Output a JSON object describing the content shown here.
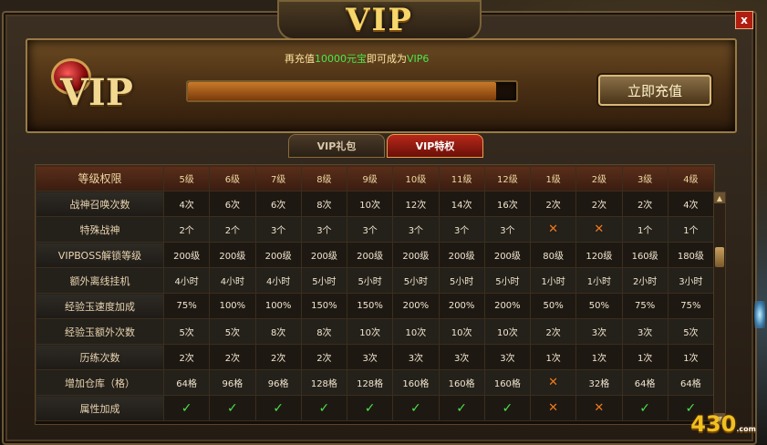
{
  "window": {
    "title": "VIP",
    "close_label": "x"
  },
  "banner": {
    "logo_text": "VIP",
    "tip_prefix": "再充值",
    "tip_amount": "10000元宝",
    "tip_middle": "即可成为",
    "tip_target": "VIP6",
    "progress": 0.94,
    "recharge_button": "立即充值"
  },
  "tabs": [
    {
      "label": "VIP礼包",
      "active": false
    },
    {
      "label": "VIP特权",
      "active": true
    }
  ],
  "table": {
    "header_label": "等级权限",
    "levels": [
      "5级",
      "6级",
      "7级",
      "8级",
      "9级",
      "10级",
      "11级",
      "12级",
      "1级",
      "2级",
      "3级",
      "4级"
    ],
    "rows": [
      {
        "label": "战神召唤次数",
        "values": [
          "4次",
          "6次",
          "6次",
          "8次",
          "10次",
          "12次",
          "14次",
          "16次",
          "2次",
          "2次",
          "2次",
          "4次"
        ]
      },
      {
        "label": "特殊战神",
        "values": [
          "2个",
          "2个",
          "3个",
          "3个",
          "3个",
          "3个",
          "3个",
          "3个",
          "x",
          "x",
          "1个",
          "1个"
        ]
      },
      {
        "label": "VIPBOSS解锁等级",
        "values": [
          "200级",
          "200级",
          "200级",
          "200级",
          "200级",
          "200级",
          "200级",
          "200级",
          "80级",
          "120级",
          "160级",
          "180级"
        ]
      },
      {
        "label": "额外离线挂机",
        "values": [
          "4小时",
          "4小时",
          "4小时",
          "5小时",
          "5小时",
          "5小时",
          "5小时",
          "5小时",
          "1小时",
          "1小时",
          "2小时",
          "3小时"
        ]
      },
      {
        "label": "经验玉速度加成",
        "values": [
          "75%",
          "100%",
          "100%",
          "150%",
          "150%",
          "200%",
          "200%",
          "200%",
          "50%",
          "50%",
          "75%",
          "75%"
        ]
      },
      {
        "label": "经验玉额外次数",
        "values": [
          "5次",
          "5次",
          "8次",
          "8次",
          "10次",
          "10次",
          "10次",
          "10次",
          "2次",
          "3次",
          "3次",
          "5次"
        ]
      },
      {
        "label": "历练次数",
        "values": [
          "2次",
          "2次",
          "2次",
          "2次",
          "3次",
          "3次",
          "3次",
          "3次",
          "1次",
          "1次",
          "1次",
          "1次"
        ]
      },
      {
        "label": "增加仓库（格）",
        "values": [
          "64格",
          "96格",
          "96格",
          "128格",
          "128格",
          "160格",
          "160格",
          "160格",
          "x",
          "32格",
          "64格",
          "64格"
        ]
      },
      {
        "label": "属性加成",
        "values": [
          "check",
          "check",
          "check",
          "check",
          "check",
          "check",
          "check",
          "check",
          "x",
          "x",
          "check",
          "check"
        ]
      }
    ]
  },
  "watermark": {
    "text": "430",
    "suffix": ".com"
  },
  "colors": {
    "accent": "#f6d66a",
    "highlight": "#49e84a",
    "cross": "#f07a1a",
    "check": "#4ae04a",
    "active_tab": "#b8281a"
  }
}
